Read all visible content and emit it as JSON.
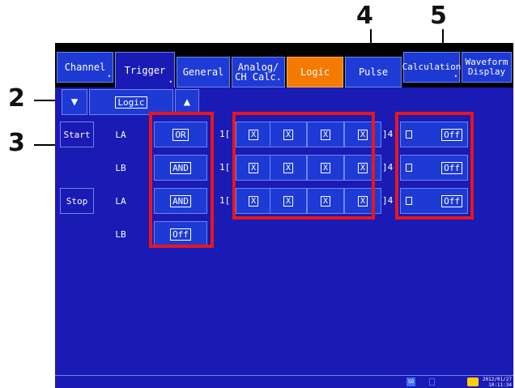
{
  "tabs_main": [
    {
      "label": "Channel"
    },
    {
      "label": "Trigger"
    },
    {
      "label": "Calculation"
    },
    {
      "label": "Waveform\nDisplay"
    }
  ],
  "tabs_sub": [
    {
      "label": "General"
    },
    {
      "label": "Analog/\nCH Calc."
    },
    {
      "label": "Logic"
    },
    {
      "label": "Pulse"
    }
  ],
  "selector": {
    "label": "Logic",
    "down_arrow": "▼",
    "up_arrow": "▲"
  },
  "rows": [
    {
      "group": "Start",
      "name": "LA",
      "mode": "OR",
      "range_start": "1[",
      "bits": [
        "X",
        "X",
        "X",
        "X"
      ],
      "range_end": "]4",
      "filter_icon": "filter-icon",
      "filter": "Off"
    },
    {
      "group": "",
      "name": "LB",
      "mode": "AND",
      "range_start": "1[",
      "bits": [
        "X",
        "X",
        "X",
        "X"
      ],
      "range_end": "]4",
      "filter_icon": "filter-icon",
      "filter": "Off"
    },
    {
      "group": "Stop",
      "name": "LA",
      "mode": "AND",
      "range_start": "1[",
      "bits": [
        "X",
        "X",
        "X",
        "X"
      ],
      "range_end": "]4",
      "filter_icon": "filter-icon",
      "filter": "Off"
    },
    {
      "group": "",
      "name": "LB",
      "mode": "Off"
    }
  ],
  "callouts": [
    "2",
    "3",
    "4",
    "5"
  ],
  "status": {
    "sd": "SD",
    "date": "2012/01/27",
    "time": "10:11:34"
  },
  "colors": {
    "screen": "#1a1ab4",
    "tab": "#1e3ad4",
    "active_tab": "#f47a00",
    "highlight_box": "#e8161d"
  }
}
